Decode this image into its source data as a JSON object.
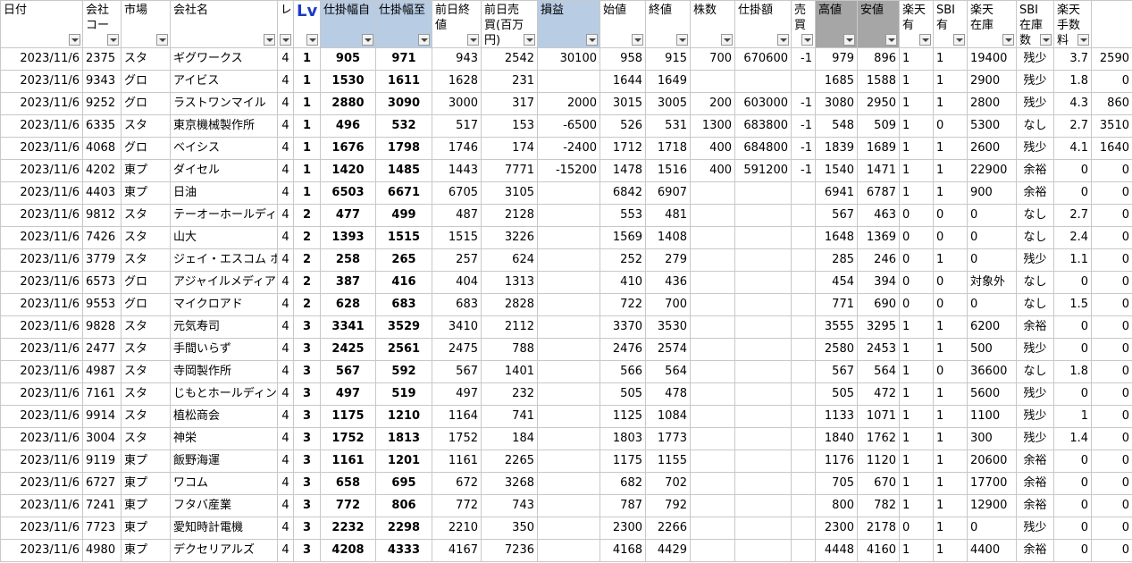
{
  "headers": [
    {
      "label": "日付",
      "style": ""
    },
    {
      "label": "会社\nコー",
      "style": ""
    },
    {
      "label": "市場",
      "style": ""
    },
    {
      "label": "会社名",
      "style": ""
    },
    {
      "label": "レ",
      "style": ""
    },
    {
      "label": "Lv",
      "style": "lv"
    },
    {
      "label": "仕掛幅自",
      "style": "blue"
    },
    {
      "label": "仕掛幅至",
      "style": "blue"
    },
    {
      "label": "前日終値",
      "style": ""
    },
    {
      "label": "前日売\n買(百万\n円)",
      "style": ""
    },
    {
      "label": "損益",
      "style": "blue"
    },
    {
      "label": "始値",
      "style": ""
    },
    {
      "label": "終値",
      "style": ""
    },
    {
      "label": "株数",
      "style": ""
    },
    {
      "label": "仕掛額",
      "style": ""
    },
    {
      "label": "売\n買",
      "style": ""
    },
    {
      "label": "高値",
      "style": "gray"
    },
    {
      "label": "安値",
      "style": "gray"
    },
    {
      "label": "楽天\n有",
      "style": ""
    },
    {
      "label": "SBI\n有",
      "style": ""
    },
    {
      "label": "楽天\n在庫",
      "style": ""
    },
    {
      "label": "SBI\n在庫\n数",
      "style": ""
    },
    {
      "label": "楽天手数料",
      "style": ""
    },
    {
      "label": "",
      "style": ""
    }
  ],
  "rows": [
    [
      "2023/11/6",
      "2375",
      "スタ",
      "ギグワークス",
      "4",
      "1",
      "905",
      "971",
      "943",
      "2542",
      "30100",
      "958",
      "915",
      "700",
      "670600",
      "-1",
      "979",
      "896",
      "1",
      "1",
      "19400",
      "残少",
      "3.7",
      "2590"
    ],
    [
      "2023/11/6",
      "9343",
      "グロ",
      "アイビス",
      "4",
      "1",
      "1530",
      "1611",
      "1628",
      "231",
      "",
      "1644",
      "1649",
      "",
      "",
      "",
      "1685",
      "1588",
      "1",
      "1",
      "2900",
      "残少",
      "1.8",
      "0"
    ],
    [
      "2023/11/6",
      "9252",
      "グロ",
      "ラストワンマイル",
      "4",
      "1",
      "2880",
      "3090",
      "3000",
      "317",
      "2000",
      "3015",
      "3005",
      "200",
      "603000",
      "-1",
      "3080",
      "2950",
      "1",
      "1",
      "2800",
      "残少",
      "4.3",
      "860"
    ],
    [
      "2023/11/6",
      "6335",
      "スタ",
      "東京機械製作所",
      "4",
      "1",
      "496",
      "532",
      "517",
      "153",
      "-6500",
      "526",
      "531",
      "1300",
      "683800",
      "-1",
      "548",
      "509",
      "1",
      "0",
      "5300",
      "なし",
      "2.7",
      "3510"
    ],
    [
      "2023/11/6",
      "4068",
      "グロ",
      "ベイシス",
      "4",
      "1",
      "1676",
      "1798",
      "1746",
      "174",
      "-2400",
      "1712",
      "1718",
      "400",
      "684800",
      "-1",
      "1839",
      "1689",
      "1",
      "1",
      "2600",
      "残少",
      "4.1",
      "1640"
    ],
    [
      "2023/11/6",
      "4202",
      "東プ",
      "ダイセル",
      "4",
      "1",
      "1420",
      "1485",
      "1443",
      "7771",
      "-15200",
      "1478",
      "1516",
      "400",
      "591200",
      "-1",
      "1540",
      "1471",
      "1",
      "1",
      "22900",
      "余裕",
      "0",
      "0"
    ],
    [
      "2023/11/6",
      "4403",
      "東プ",
      "日油",
      "4",
      "1",
      "6503",
      "6671",
      "6705",
      "3105",
      "",
      "6842",
      "6907",
      "",
      "",
      "",
      "6941",
      "6787",
      "1",
      "1",
      "900",
      "余裕",
      "0",
      "0"
    ],
    [
      "2023/11/6",
      "9812",
      "スタ",
      "テーオーホールディ",
      "4",
      "2",
      "477",
      "499",
      "487",
      "2128",
      "",
      "553",
      "481",
      "",
      "",
      "",
      "567",
      "463",
      "0",
      "0",
      "0",
      "なし",
      "2.7",
      "0"
    ],
    [
      "2023/11/6",
      "7426",
      "スタ",
      "山大",
      "4",
      "2",
      "1393",
      "1515",
      "1515",
      "3226",
      "",
      "1569",
      "1408",
      "",
      "",
      "",
      "1648",
      "1369",
      "0",
      "0",
      "0",
      "なし",
      "2.4",
      "0"
    ],
    [
      "2023/11/6",
      "3779",
      "スタ",
      "ジェイ・エスコム ホ",
      "4",
      "2",
      "258",
      "265",
      "257",
      "624",
      "",
      "252",
      "279",
      "",
      "",
      "",
      "285",
      "246",
      "0",
      "1",
      "0",
      "残少",
      "1.1",
      "0"
    ],
    [
      "2023/11/6",
      "6573",
      "グロ",
      "アジャイルメディア",
      "4",
      "2",
      "387",
      "416",
      "404",
      "1313",
      "",
      "410",
      "436",
      "",
      "",
      "",
      "454",
      "394",
      "0",
      "0",
      "対象外",
      "なし",
      "0",
      "0"
    ],
    [
      "2023/11/6",
      "9553",
      "グロ",
      "マイクロアド",
      "4",
      "2",
      "628",
      "683",
      "683",
      "2828",
      "",
      "722",
      "700",
      "",
      "",
      "",
      "771",
      "690",
      "0",
      "0",
      "0",
      "なし",
      "1.5",
      "0"
    ],
    [
      "2023/11/6",
      "9828",
      "スタ",
      "元気寿司",
      "4",
      "3",
      "3341",
      "3529",
      "3410",
      "2112",
      "",
      "3370",
      "3530",
      "",
      "",
      "",
      "3555",
      "3295",
      "1",
      "1",
      "6200",
      "余裕",
      "0",
      "0"
    ],
    [
      "2023/11/6",
      "2477",
      "スタ",
      "手間いらず",
      "4",
      "3",
      "2425",
      "2561",
      "2475",
      "788",
      "",
      "2476",
      "2574",
      "",
      "",
      "",
      "2580",
      "2453",
      "1",
      "1",
      "500",
      "残少",
      "0",
      "0"
    ],
    [
      "2023/11/6",
      "4987",
      "スタ",
      "寺岡製作所",
      "4",
      "3",
      "567",
      "592",
      "567",
      "1401",
      "",
      "566",
      "564",
      "",
      "",
      "",
      "567",
      "564",
      "1",
      "0",
      "36600",
      "なし",
      "1.8",
      "0"
    ],
    [
      "2023/11/6",
      "7161",
      "スタ",
      "じもとホールディン",
      "4",
      "3",
      "497",
      "519",
      "497",
      "232",
      "",
      "505",
      "478",
      "",
      "",
      "",
      "505",
      "472",
      "1",
      "1",
      "5600",
      "残少",
      "0",
      "0"
    ],
    [
      "2023/11/6",
      "9914",
      "スタ",
      "植松商会",
      "4",
      "3",
      "1175",
      "1210",
      "1164",
      "741",
      "",
      "1125",
      "1084",
      "",
      "",
      "",
      "1133",
      "1071",
      "1",
      "1",
      "1100",
      "残少",
      "1",
      "0"
    ],
    [
      "2023/11/6",
      "3004",
      "スタ",
      "神栄",
      "4",
      "3",
      "1752",
      "1813",
      "1752",
      "184",
      "",
      "1803",
      "1773",
      "",
      "",
      "",
      "1840",
      "1762",
      "1",
      "1",
      "300",
      "残少",
      "1.4",
      "0"
    ],
    [
      "2023/11/6",
      "9119",
      "東プ",
      "飯野海運",
      "4",
      "3",
      "1161",
      "1201",
      "1161",
      "2265",
      "",
      "1175",
      "1155",
      "",
      "",
      "",
      "1176",
      "1120",
      "1",
      "1",
      "20600",
      "余裕",
      "0",
      "0"
    ],
    [
      "2023/11/6",
      "6727",
      "東プ",
      "ワコム",
      "4",
      "3",
      "658",
      "695",
      "672",
      "3268",
      "",
      "682",
      "702",
      "",
      "",
      "",
      "705",
      "670",
      "1",
      "1",
      "17700",
      "余裕",
      "0",
      "0"
    ],
    [
      "2023/11/6",
      "7241",
      "東プ",
      "フタバ産業",
      "4",
      "3",
      "772",
      "806",
      "772",
      "743",
      "",
      "787",
      "792",
      "",
      "",
      "",
      "800",
      "782",
      "1",
      "1",
      "12900",
      "余裕",
      "0",
      "0"
    ],
    [
      "2023/11/6",
      "7723",
      "東プ",
      "愛知時計電機",
      "4",
      "3",
      "2232",
      "2298",
      "2210",
      "350",
      "",
      "2300",
      "2266",
      "",
      "",
      "",
      "2300",
      "2178",
      "0",
      "1",
      "0",
      "残少",
      "0",
      "0"
    ],
    [
      "2023/11/6",
      "4980",
      "東プ",
      "デクセリアルズ",
      "4",
      "3",
      "4208",
      "4333",
      "4167",
      "7236",
      "",
      "4168",
      "4429",
      "",
      "",
      "",
      "4448",
      "4160",
      "1",
      "1",
      "4400",
      "余裕",
      "0",
      "0"
    ]
  ]
}
